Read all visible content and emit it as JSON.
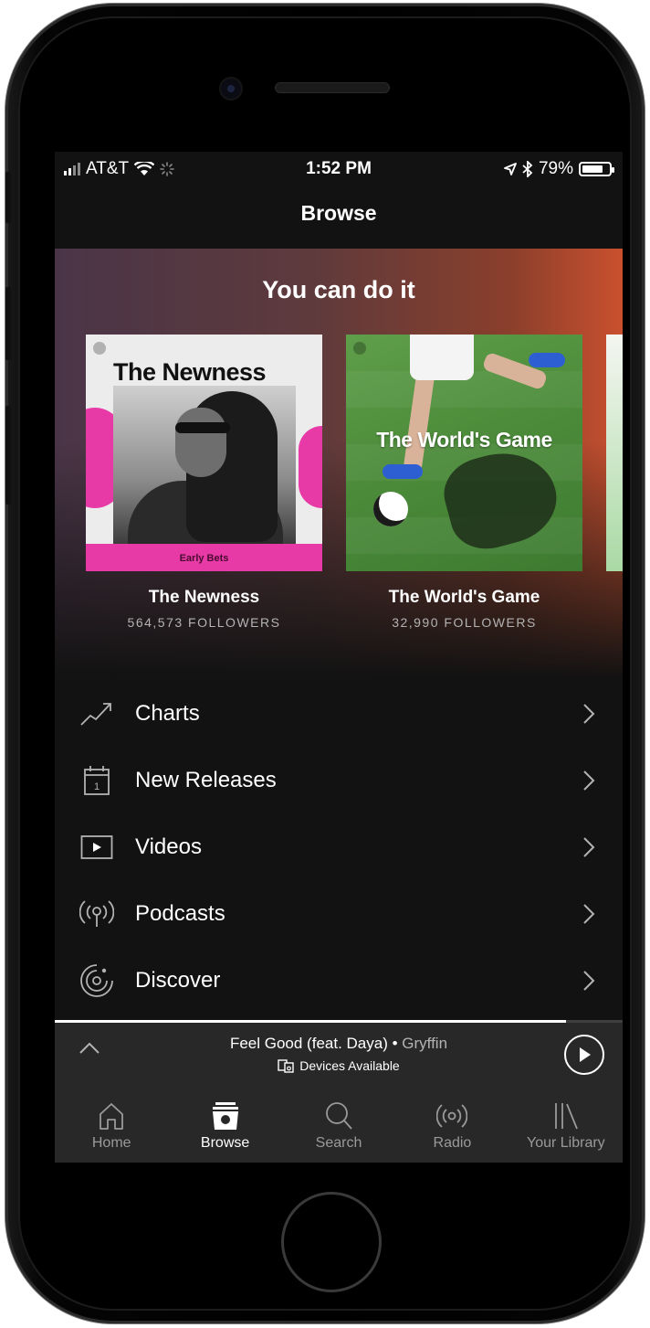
{
  "status_bar": {
    "carrier": "AT&T",
    "time": "1:52 PM",
    "battery": "79%",
    "battery_level": 0.79
  },
  "nav": {
    "title": "Browse"
  },
  "hero": {
    "title": "You can do it",
    "playlists": [
      {
        "name": "The Newness",
        "followers": "564,573 FOLLOWERS",
        "cover_title": "The Newness",
        "cover_subtitle": "Early Bets"
      },
      {
        "name": "The World's Game",
        "followers": "32,990 FOLLOWERS",
        "cover_title": "The World's Game"
      }
    ]
  },
  "menu": {
    "items": [
      {
        "label": "Charts",
        "icon": "trending-up-icon"
      },
      {
        "label": "New Releases",
        "icon": "calendar-icon",
        "icon_text": "1"
      },
      {
        "label": "Videos",
        "icon": "video-icon"
      },
      {
        "label": "Podcasts",
        "icon": "podcast-icon"
      },
      {
        "label": "Discover",
        "icon": "discover-icon"
      }
    ]
  },
  "player": {
    "track": "Feel Good (feat. Daya)",
    "separator": " • ",
    "artist": "Gryffin",
    "devices": "Devices Available",
    "progress": 0.9
  },
  "tabs": [
    {
      "label": "Home",
      "icon": "home-icon",
      "active": false
    },
    {
      "label": "Browse",
      "icon": "browse-icon",
      "active": true
    },
    {
      "label": "Search",
      "icon": "search-icon",
      "active": false
    },
    {
      "label": "Radio",
      "icon": "radio-icon",
      "active": false
    },
    {
      "label": "Your Library",
      "icon": "library-icon",
      "active": false
    }
  ],
  "colors": {
    "background": "#121212",
    "bar": "#282828",
    "accent_pink": "#e83aa6",
    "muted_text": "#b3b3b3"
  }
}
